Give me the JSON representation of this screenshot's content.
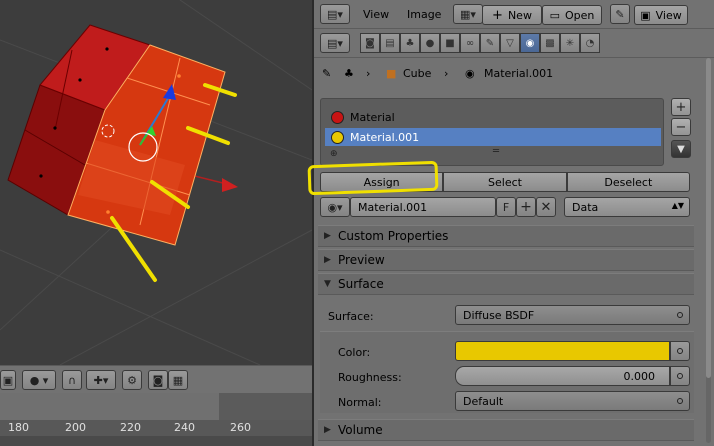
{
  "header": {
    "menu_view": "View",
    "menu_image": "Image",
    "btn_new": "New",
    "btn_open": "Open",
    "menu_view2": "View"
  },
  "breadcrumb": {
    "object": "Cube",
    "material": "Material.001"
  },
  "materials": {
    "slots": [
      {
        "name": "Material",
        "color": "#c81414"
      },
      {
        "name": "Material.001",
        "color": "#e8c800"
      }
    ],
    "selected_index": 1
  },
  "actions": {
    "assign": "Assign",
    "select": "Select",
    "deselect": "Deselect"
  },
  "datablock": {
    "name": "Material.001",
    "fake_user": "F",
    "link": "Data"
  },
  "panels": {
    "custom_properties": "Custom Properties",
    "preview": "Preview",
    "surface": "Surface",
    "volume": "Volume"
  },
  "surface": {
    "surface_label": "Surface:",
    "surface_value": "Diffuse BSDF",
    "color_label": "Color:",
    "color_value": "#e8c800",
    "roughness_label": "Roughness:",
    "roughness_value": "0.000",
    "normal_label": "Normal:",
    "normal_value": "Default"
  },
  "timeline": {
    "ticks": [
      "180",
      "200",
      "220",
      "240",
      "260"
    ]
  },
  "colors": {
    "accent": "#5680c2",
    "annotation": "#f0e000"
  }
}
